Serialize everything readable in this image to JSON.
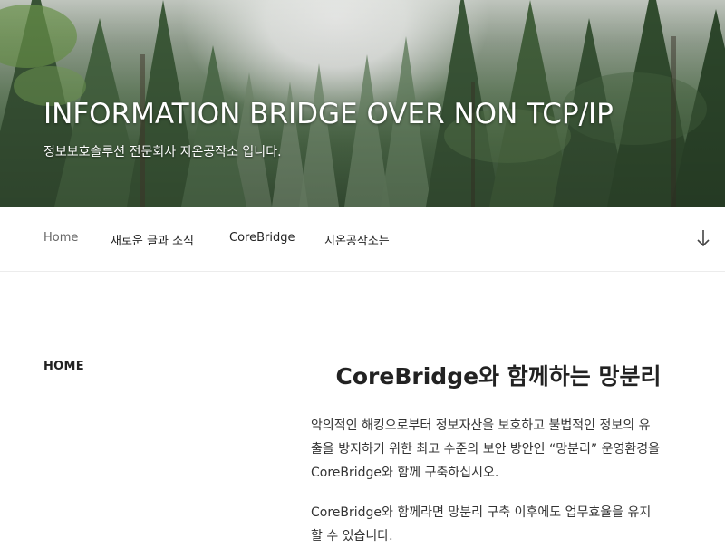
{
  "header": {
    "site_title": "INFORMATION BRIDGE OVER NON TCP/IP",
    "site_description": "정보보호솔루션 전문회사 지온공작소 입니다."
  },
  "nav": {
    "items": [
      {
        "label": "Home",
        "current": true
      },
      {
        "label": "새로운 글과 소식",
        "current": false
      },
      {
        "label": "CoreBridge",
        "current": false
      },
      {
        "label": "지온공작소는",
        "current": false
      }
    ],
    "scroll_icon": "arrow-down-icon"
  },
  "main": {
    "page_label": "HOME",
    "title": "CoreBridge와 함께하는 망분리",
    "paragraph1_lines": [
      "악의적인 해킹으로부터  정보자산을 보호하고  불법적인 정보의 유",
      "출을 방지하기 위한 최고 수준의 보안 방안인 “망분리” 운영환경을",
      " CoreBridge와  함께  구축하십시오."
    ],
    "paragraph2_lines": [
      "CoreBridge와 함께라면  망분리 구축 이후에도 업무효율을 유지",
      "할 수 있습니다."
    ]
  },
  "colors": {
    "title_text": "#222222",
    "body_text": "#333333",
    "nav_current": "#666666",
    "header_text": "#ffffff"
  }
}
